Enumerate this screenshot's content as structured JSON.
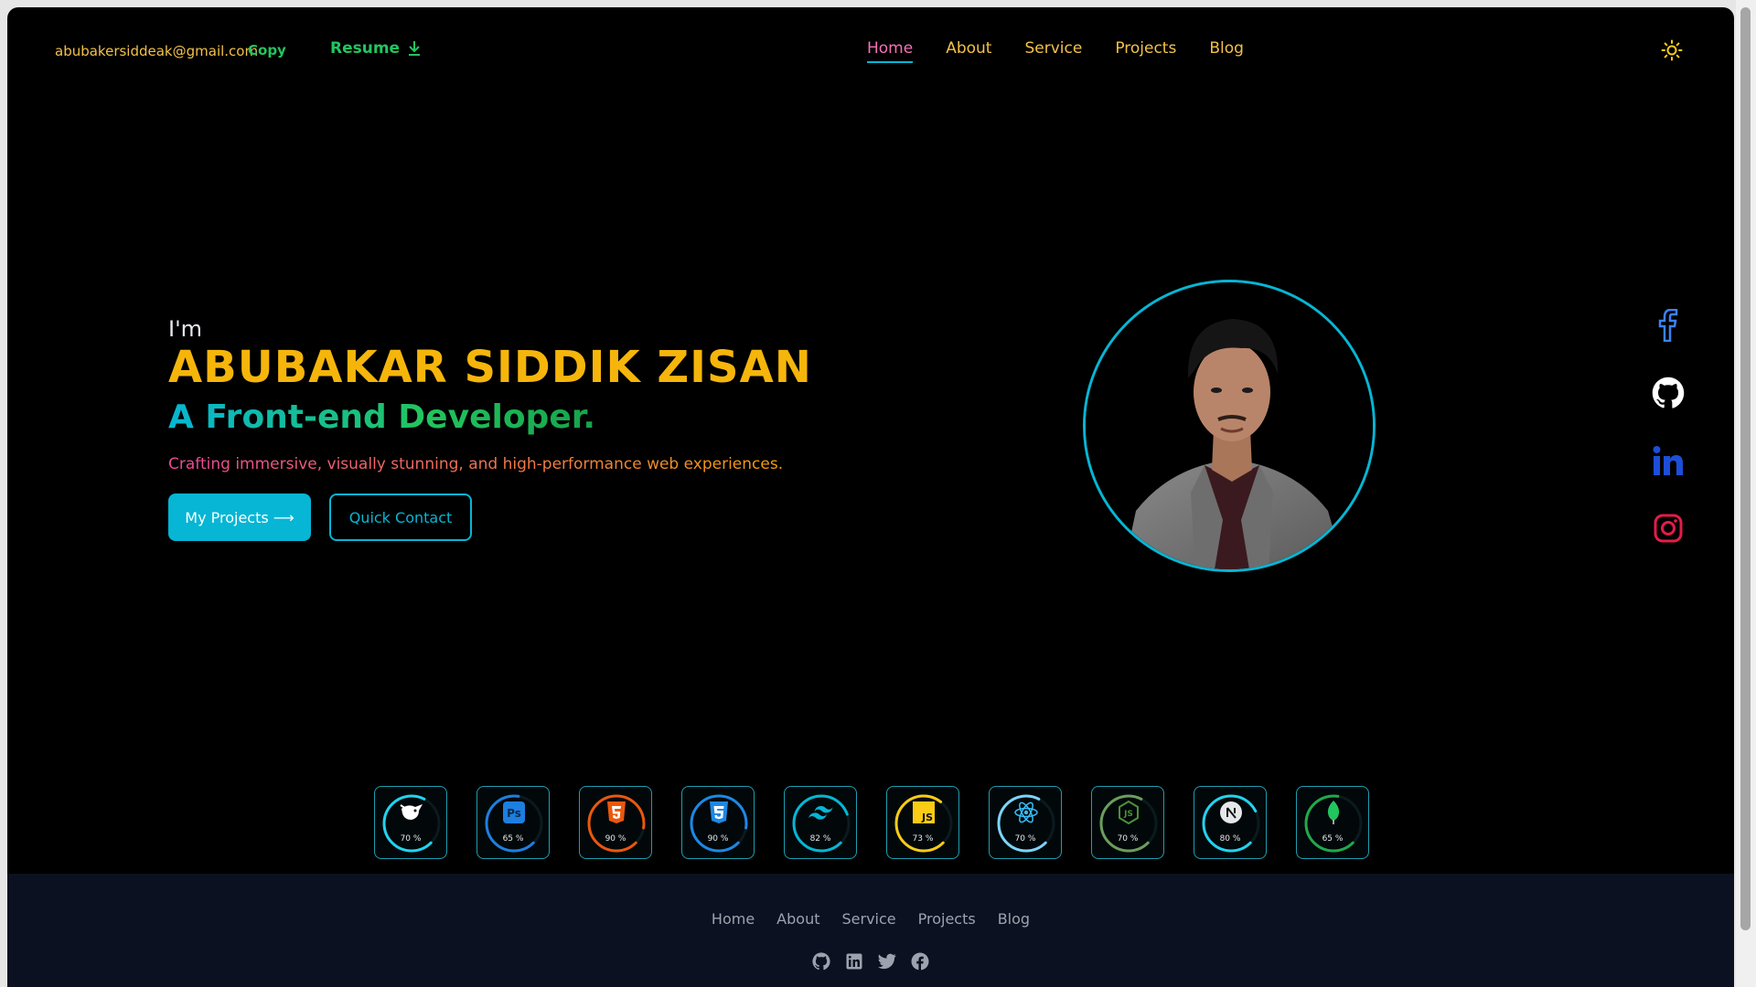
{
  "header": {
    "email": "abubakersiddeak@gmail.com",
    "copy_label": "Copy",
    "resume_label": "Resume",
    "nav": [
      {
        "label": "Home",
        "active": true
      },
      {
        "label": "About",
        "active": false
      },
      {
        "label": "Service",
        "active": false
      },
      {
        "label": "Projects",
        "active": false
      },
      {
        "label": "Blog",
        "active": false
      }
    ],
    "theme_icon": "sun-icon"
  },
  "hero": {
    "intro": "I'm",
    "name": "ABUBAKAR SIDDIK ZISAN",
    "role": "A Front-end Developer.",
    "description": "Crafting immersive, visually stunning, and high-performance web experiences.",
    "primary_button": "My Projects ⟶",
    "secondary_button": "Quick Contact",
    "avatar_icon": "profile-photo"
  },
  "socials": [
    {
      "icon": "facebook-icon",
      "color": "#3b82f6"
    },
    {
      "icon": "github-icon",
      "color": "#ffffff"
    },
    {
      "icon": "linkedin-icon",
      "color": "#1d4ed8"
    },
    {
      "icon": "instagram-icon",
      "color": "#e11d48"
    }
  ],
  "skills": [
    {
      "icon": "gimp-icon",
      "percent": "70 %",
      "value": 70,
      "color": "#22d3ee"
    },
    {
      "icon": "photoshop-icon",
      "percent": "65 %",
      "value": 65,
      "color": "#1d7fe0"
    },
    {
      "icon": "html5-icon",
      "percent": "90 %",
      "value": 90,
      "color": "#ea580c"
    },
    {
      "icon": "css3-icon",
      "percent": "90 %",
      "value": 90,
      "color": "#1e88e5"
    },
    {
      "icon": "tailwind-icon",
      "percent": "82 %",
      "value": 82,
      "color": "#06b6d4"
    },
    {
      "icon": "javascript-icon",
      "percent": "73 %",
      "value": 73,
      "color": "#facc15"
    },
    {
      "icon": "react-icon",
      "percent": "70 %",
      "value": 70,
      "color": "#7dd3fc"
    },
    {
      "icon": "nodejs-icon",
      "percent": "70 %",
      "value": 70,
      "color": "#6b9e5c"
    },
    {
      "icon": "nextjs-icon",
      "percent": "80 %",
      "value": 80,
      "color": "#22d3ee"
    },
    {
      "icon": "mongodb-icon",
      "percent": "65 %",
      "value": 65,
      "color": "#22a84a"
    }
  ],
  "footer": {
    "nav": [
      "Home",
      "About",
      "Service",
      "Projects",
      "Blog"
    ],
    "icons": [
      "github-icon",
      "linkedin-icon",
      "twitter-icon",
      "facebook-icon"
    ]
  }
}
